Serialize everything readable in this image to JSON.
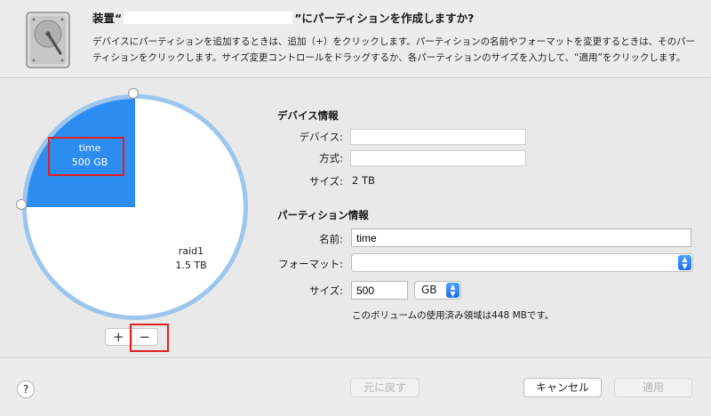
{
  "header": {
    "title_prefix": "装置“",
    "title_suffix": "”にパーティションを作成しますか?",
    "description": "デバイスにパーティションを追加するときは、追加（+）をクリックします。パーティションの名前やフォーマットを変更するときは、そのパーティションをクリックします。サイズ変更コントロールをドラッグするか、各パーティションのサイズを入力して、“適用”をクリックします。"
  },
  "pie": {
    "chart_data": {
      "type": "pie",
      "slices": [
        {
          "name": "time",
          "size_label": "500 GB",
          "value": 500,
          "color": "#2d8cf0"
        },
        {
          "name": "raid1",
          "size_label": "1.5 TB",
          "value": 1500,
          "color": "#ffffff"
        }
      ],
      "ring_color": "#9cc6ee"
    }
  },
  "controls": {
    "add": "+",
    "remove": "−"
  },
  "device_info": {
    "title": "デバイス情報",
    "device_label": "デバイス:",
    "device_value": "",
    "scheme_label": "方式:",
    "scheme_value": "",
    "size_label": "サイズ:",
    "size_value": "2 TB"
  },
  "partition_info": {
    "title": "パーティション情報",
    "name_label": "名前:",
    "name_value": "time",
    "format_label": "フォーマット:",
    "format_value": "",
    "size_label": "サイズ:",
    "size_value": "500",
    "unit_value": "GB",
    "note": "このボリュームの使用済み領域は448 MBです。"
  },
  "footer": {
    "help": "?",
    "revert": "元に戻す",
    "cancel": "キャンセル",
    "apply": "適用"
  },
  "colors": {
    "accent": "#2d8cf0",
    "highlight_box": "#e02020"
  }
}
